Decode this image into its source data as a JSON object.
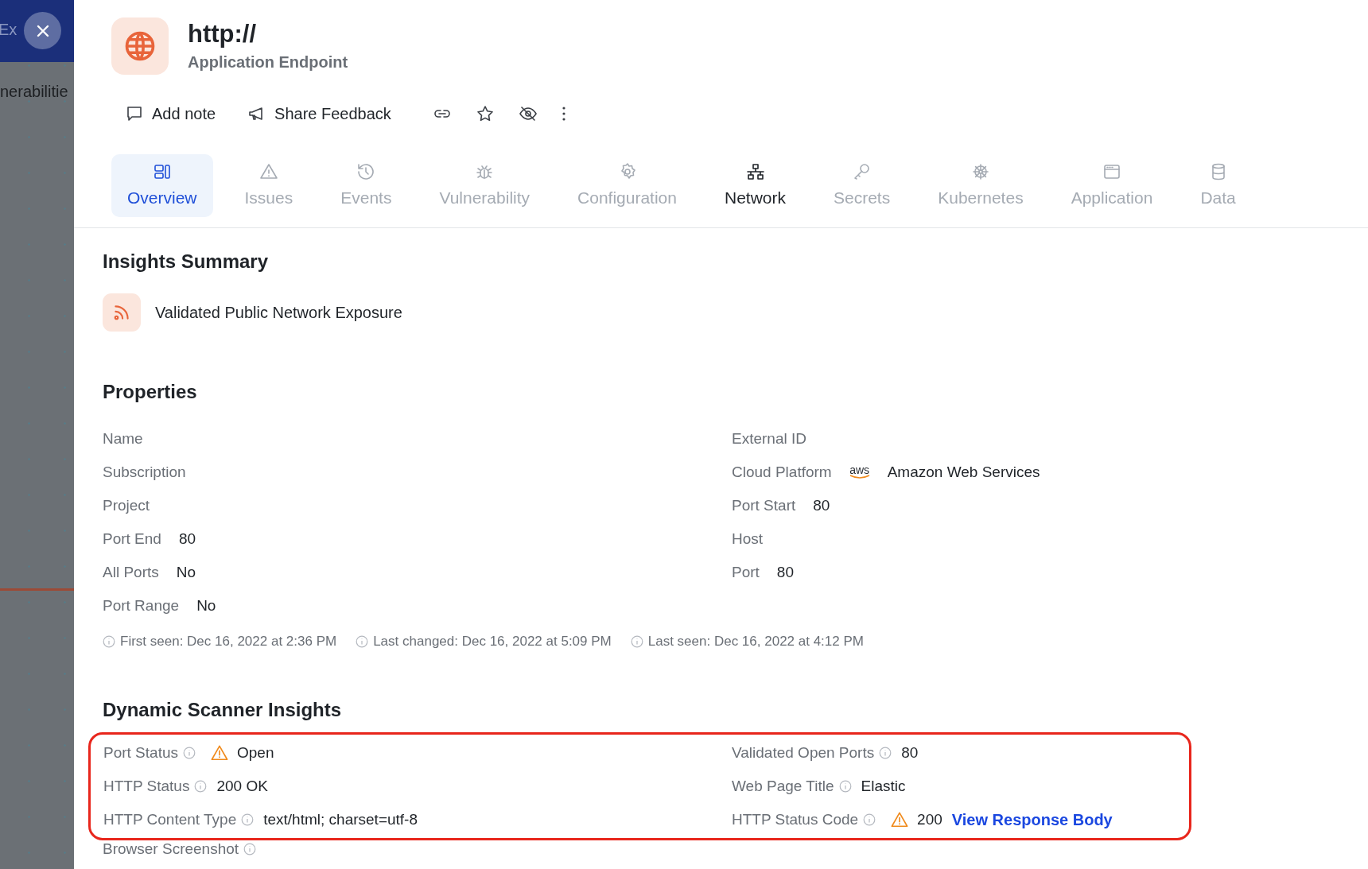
{
  "background": {
    "nav_title": "Ex",
    "breadcrumb": "nerabilitie"
  },
  "header": {
    "title": "http://",
    "subtitle": "Application Endpoint"
  },
  "toolbar": [
    {
      "kind": "note",
      "label": "Add note"
    },
    {
      "kind": "feedback",
      "label": "Share Feedback"
    },
    {
      "kind": "link"
    },
    {
      "kind": "star"
    },
    {
      "kind": "hide"
    },
    {
      "kind": "more"
    }
  ],
  "tabs": [
    {
      "kind": "overview",
      "label": "Overview",
      "selected": true,
      "disabled": false
    },
    {
      "kind": "issues",
      "label": "Issues",
      "selected": false,
      "disabled": true
    },
    {
      "kind": "events",
      "label": "Events",
      "selected": false,
      "disabled": true
    },
    {
      "kind": "vulnerability",
      "label": "Vulnerability",
      "selected": false,
      "disabled": true
    },
    {
      "kind": "configuration",
      "label": "Configuration",
      "selected": false,
      "disabled": true
    },
    {
      "kind": "network",
      "label": "Network",
      "selected": false,
      "disabled": false
    },
    {
      "kind": "secrets",
      "label": "Secrets",
      "selected": false,
      "disabled": true
    },
    {
      "kind": "kubernetes",
      "label": "Kubernetes",
      "selected": false,
      "disabled": true
    },
    {
      "kind": "application",
      "label": "Application",
      "selected": false,
      "disabled": true
    },
    {
      "kind": "data",
      "label": "Data",
      "selected": false,
      "disabled": true
    }
  ],
  "insights_summary": {
    "title": "Insights Summary",
    "items": [
      {
        "label": "Validated Public Network Exposure"
      }
    ]
  },
  "properties": {
    "title": "Properties",
    "left": [
      {
        "label": "Name"
      },
      {
        "label": "Subscription"
      },
      {
        "label": "Project"
      },
      {
        "label": "Port End",
        "value": "80"
      },
      {
        "label": "All Ports",
        "value": "No"
      },
      {
        "label": "Port Range",
        "value": "No"
      }
    ],
    "right": [
      {
        "label": "External ID"
      },
      {
        "label": "Cloud Platform",
        "value": "Amazon Web Services",
        "logo_text": "aws"
      },
      {
        "label": "Port Start",
        "value": "80"
      },
      {
        "label": "Host"
      },
      {
        "label": "Port",
        "value": "80"
      }
    ],
    "timestamps": [
      "First seen: Dec 16, 2022 at 2:36 PM",
      "Last changed: Dec 16, 2022 at 5:09 PM",
      "Last seen: Dec 16, 2022 at 4:12 PM"
    ]
  },
  "dynamic_scanner": {
    "title": "Dynamic Scanner Insights",
    "highlighted": true,
    "left": [
      {
        "label": "Port Status",
        "value": "Open",
        "warning": true
      },
      {
        "label": "HTTP Status",
        "value": "200 OK",
        "warning": false
      },
      {
        "label": "HTTP Content Type",
        "value": "text/html; charset=utf-8",
        "warning": false
      }
    ],
    "right": [
      {
        "label": "Validated Open Ports",
        "value": "80",
        "warning": false
      },
      {
        "label": "Web Page Title",
        "value": "Elastic",
        "warning": false
      },
      {
        "label": "HTTP Status Code",
        "value": "200",
        "warning": true,
        "link": "View Response Body"
      }
    ]
  },
  "browser_screenshot": {
    "label": "Browser Screenshot"
  }
}
